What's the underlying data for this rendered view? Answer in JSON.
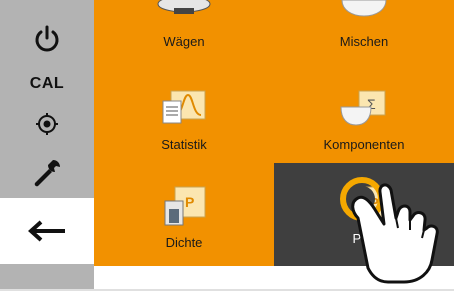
{
  "sidebar": {
    "power_icon": "power-icon",
    "cal_label": "CAL",
    "target_icon": "target-icon",
    "wrench_icon": "wrench-icon",
    "back_icon": "arrow-left-icon"
  },
  "tiles": [
    {
      "label": "Wägen",
      "icon": "scale-icon"
    },
    {
      "label": "Mischen",
      "icon": "mixing-bowl-icon"
    },
    {
      "label": "Statistik",
      "icon": "statistics-icon"
    },
    {
      "label": "Komponenten",
      "icon": "components-icon"
    },
    {
      "label": "Dichte",
      "icon": "density-icon"
    },
    {
      "label": "Pr...",
      "icon": "p-icon",
      "selected": true
    }
  ],
  "colors": {
    "accent": "#f29100",
    "sidebar": "#b3b3b3",
    "selected_tile": "#3f3f3f",
    "highlight_ring": "#f5a800"
  },
  "pointer": "hand-pointer-icon"
}
